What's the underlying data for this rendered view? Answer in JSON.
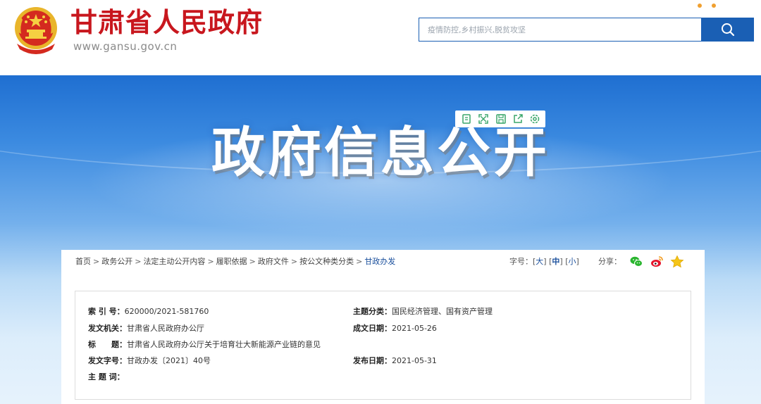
{
  "header": {
    "site_title": "甘肃省人民政府",
    "site_url": "www.gansu.gov.cn",
    "emblem_icon": "national-emblem-icon",
    "search": {
      "placeholder": "疫情防控,乡村振兴,脱贫攻坚",
      "button_icon": "search-icon"
    },
    "brand_color": "#c8171e",
    "accent_color": "#1a5fb4"
  },
  "banner": {
    "title": "政府信息公开",
    "toolbar_icons": [
      "bookmark-icon",
      "fullscreen-icon",
      "save-icon",
      "share-out-icon",
      "settings-icon"
    ]
  },
  "panel": {
    "breadcrumb": [
      "首页",
      "政务公开",
      "法定主动公开内容",
      "履职依据",
      "政府文件",
      "按公文种类分类",
      "甘政办发"
    ],
    "font_size": {
      "label": "字号：",
      "large": "大",
      "medium": "中",
      "small": "小"
    },
    "share_label": "分享：",
    "share_icons": [
      "wechat-icon",
      "weibo-icon",
      "favorite-star-icon"
    ]
  },
  "meta": {
    "index_no": {
      "label": "索 引 号：",
      "value": "620000/2021-581760"
    },
    "topic": {
      "label": "主题分类：",
      "value": "国民经济管理、国有资产管理"
    },
    "issuer": {
      "label": "发文机关：",
      "value": "甘肃省人民政府办公厅"
    },
    "date_created": {
      "label": "成文日期：",
      "value": "2021-05-26"
    },
    "title": {
      "label": "标　　题：",
      "value": "甘肃省人民政府办公厅关于培育壮大新能源产业链的意见"
    },
    "doc_no": {
      "label": "发文字号：",
      "value": "甘政办发〔2021〕40号"
    },
    "date_published": {
      "label": "发布日期：",
      "value": "2021-05-31"
    },
    "keywords": {
      "label": "主 题 词：",
      "value": ""
    }
  }
}
